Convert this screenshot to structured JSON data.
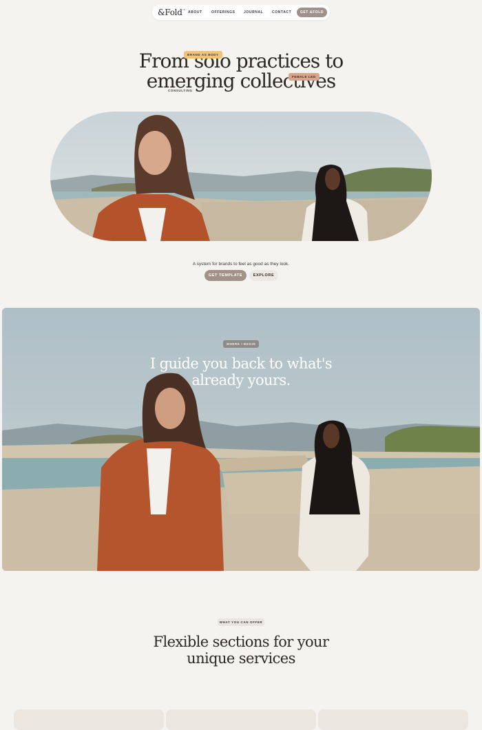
{
  "brand": {
    "logo": "&Fold",
    "tm": "™"
  },
  "nav": {
    "links": [
      "ABOUT",
      "OFFERINGS",
      "JOURNAL",
      "CONTACT"
    ],
    "cta": "GET &FOLD"
  },
  "hero": {
    "title_line1": "From solo practices to",
    "title_line2": "emerging collectives",
    "tags": {
      "brand": "BRAND AS BODY",
      "female": "FEMALE LED",
      "consulting": "CONSULTING"
    },
    "tagline": "A system for brands to feel as good as they look.",
    "primary_button": "GET TEMPLATE",
    "secondary_button": "EXPLORE"
  },
  "banner": {
    "tag": "WHERE I BEGIN",
    "title_line1": "I guide you back to what's",
    "title_line2": "already yours."
  },
  "offer": {
    "tag": "WHAT YOU CAN OFFER",
    "title_line1": "Flexible sections for your",
    "title_line2": "unique services"
  },
  "colors": {
    "background": "#f5f3f0",
    "accent": "#a0928a",
    "tag_yellow": "#f2c27a",
    "tag_rose": "#d8a48b"
  }
}
